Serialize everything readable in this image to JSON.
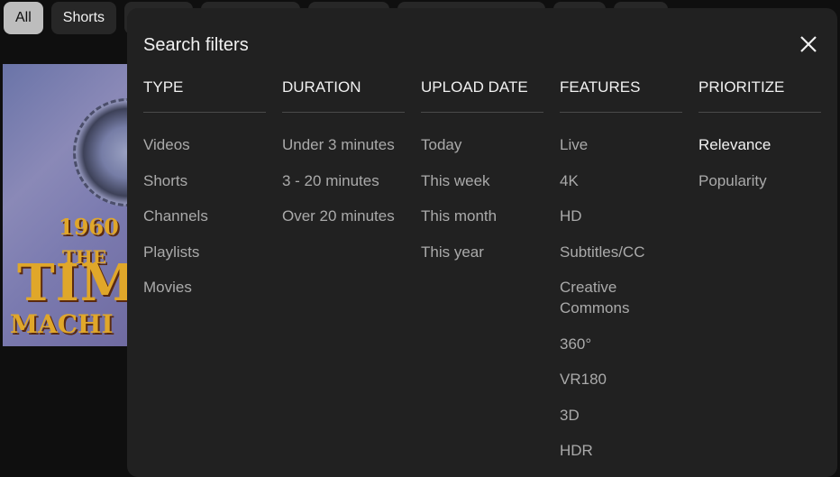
{
  "chips": [
    {
      "label": "All",
      "active": true
    },
    {
      "label": "Shorts",
      "active": false
    },
    {
      "label": "",
      "active": false
    },
    {
      "label": "",
      "active": false
    },
    {
      "label": "",
      "active": false
    },
    {
      "label": "",
      "active": false
    },
    {
      "label": "",
      "active": false
    },
    {
      "label": "",
      "active": false
    }
  ],
  "thumbnail": {
    "year": "1960",
    "the": "THE",
    "title_line1": "TIM",
    "title_line2": "MACHI"
  },
  "dialog": {
    "title": "Search filters",
    "close_icon": "close-icon",
    "columns": [
      {
        "header": "TYPE",
        "options": [
          "Videos",
          "Shorts",
          "Channels",
          "Playlists",
          "Movies"
        ]
      },
      {
        "header": "DURATION",
        "options": [
          "Under 3 minutes",
          "3 - 20 minutes",
          "Over 20 minutes"
        ]
      },
      {
        "header": "UPLOAD DATE",
        "options": [
          "Today",
          "This week",
          "This month",
          "This year"
        ]
      },
      {
        "header": "FEATURES",
        "options": [
          "Live",
          "4K",
          "HD",
          "Subtitles/CC",
          "Creative Commons",
          "360°",
          "VR180",
          "3D",
          "HDR"
        ]
      },
      {
        "header": "PRIORITIZE",
        "options": [
          "Relevance",
          "Popularity"
        ],
        "selected": "Relevance"
      }
    ]
  },
  "colors": {
    "background": "#0f0f0f",
    "dialog": "#212121",
    "option_text": "#aaaaaa",
    "selected_text": "#f1f1f1"
  }
}
